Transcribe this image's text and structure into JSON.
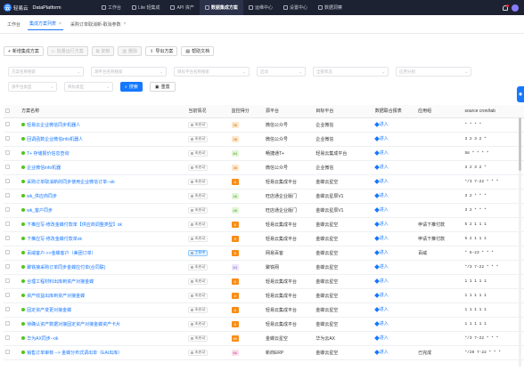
{
  "topnav": {
    "logo": "轻易云",
    "app_name": "DataPlatform",
    "items": [
      {
        "label": "工作台",
        "active": false
      },
      {
        "label": "Lite 轻集成",
        "active": false
      },
      {
        "label": "API 资产",
        "active": false
      },
      {
        "label": "数据集成方案",
        "active": true
      },
      {
        "label": "运维中心",
        "active": false
      },
      {
        "label": "设置中心",
        "active": false
      },
      {
        "label": "数据洞察",
        "active": false
      }
    ]
  },
  "tabs": [
    {
      "label": "工作台",
      "active": false
    },
    {
      "label": "集成方案列表",
      "active": true
    },
    {
      "label": "采购订单取消新-取消参数",
      "active": false
    }
  ],
  "toolbar": {
    "new": "新增集成方案",
    "batch_run": "批量运行方案",
    "copy": "复制",
    "delete": "删除",
    "export": "导出方案",
    "help": "帮助文档"
  },
  "filters": {
    "row1": [
      {
        "placeholder": "方案名称搜索",
        "w": 85
      },
      {
        "placeholder": "源平台名称搜索",
        "w": 85
      },
      {
        "placeholder": "目标平台名称搜索",
        "w": 85
      },
      {
        "placeholder": "启动",
        "w": 55
      },
      {
        "placeholder": "全部状态",
        "w": 85
      },
      {
        "placeholder": "应用分组",
        "w": 85
      }
    ],
    "row2": [
      {
        "placeholder": "源平台类型",
        "w": 55
      },
      {
        "placeholder": "目标类型",
        "w": 55
      }
    ],
    "search": "搜索",
    "reset": "重置"
  },
  "table": {
    "headers": [
      "方案名称",
      "当前情况",
      "监控得分",
      "源平台",
      "目标平台",
      "数据联合报表",
      "应用组",
      "source cron/tab"
    ],
    "rows": [
      {
        "name": "轻易云企业微信同步机器人",
        "status": "未启动",
        "score": "38",
        "sc": "lorange",
        "src": "微信公众号",
        "dst": "企业微信",
        "rep": "进入",
        "grp": "",
        "cron": "* * * *"
      },
      {
        "name": "回调函数企业微信info机器人",
        "status": "未启动",
        "score": "38",
        "sc": "lorange",
        "src": "微信公众号",
        "dst": "企业微信",
        "rep": "进入",
        "grp": "",
        "cron": "3 2 3 2 *"
      },
      {
        "name": "T+ 存储报价信息查询",
        "status": "未启动",
        "score": "84",
        "sc": "lgreen",
        "src": "畅捷通T+",
        "dst": "轻易云集成平台",
        "rep": "进入",
        "grp": "",
        "cron": "58 * * * *"
      },
      {
        "name": "企业微信info机器",
        "status": "未启动",
        "score": "38",
        "sc": "lorange",
        "src": "微信公众号",
        "dst": "企业微信",
        "rep": "进入",
        "grp": "",
        "cron": "3 2 3 2 *"
      },
      {
        "name": "采购订单取消新的同步使用企业微信订单--ok",
        "status": "未启动",
        "score": "8",
        "sc": "orange",
        "src": "轻易云集成平台",
        "dst": "金蝶云星空",
        "rep": "进入",
        "grp": "",
        "cron": "*/3 7-22 * * *"
      },
      {
        "name": "wk_供应商同步",
        "status": "未启动",
        "score": "46",
        "sc": "lgreen",
        "src": "旺店通企业版门",
        "dst": "金蝶云星辰V1",
        "rep": "进入",
        "grp": "",
        "cron": "3 2 * * *"
      },
      {
        "name": "wk_客户同步",
        "status": "未启动",
        "score": "46",
        "sc": "lgreen",
        "src": "旺店通企业版门",
        "dst": "金蝶云星辰V1",
        "rep": "进入",
        "grp": "",
        "cron": "3 2 * * *"
      },
      {
        "name": "下推应写-修改金蝶付款单【供应商调整类型】ok",
        "status": "未启动",
        "score": "8",
        "sc": "orange",
        "src": "轻易云集成平台",
        "dst": "金蝶云星空",
        "rep": "进入",
        "grp": "申请下推付款",
        "cron": "5 2 1 1 1"
      },
      {
        "name": "下推应写-修改金蝶付款单ok",
        "status": "未启动",
        "score": "8",
        "sc": "orange",
        "src": "轻易云集成平台",
        "dst": "金蝶云星空",
        "rep": "进入",
        "grp": "申请下推付款",
        "cron": "5 2 1 1 1"
      },
      {
        "name": "百威客户->>金蝶客户（美团订单）",
        "status": "工作中",
        "score": "8",
        "sc": "orange",
        "src": "网易百客",
        "dst": "金蝶云星空",
        "rep": "进入",
        "grp": "百威",
        "cron": "* 6-23 * * *"
      },
      {
        "name": "聚铁接采购订单同步金蝶应付单(合同联)",
        "status": "未启动",
        "score": "64",
        "sc": "lpurple",
        "src": "聚铁网",
        "dst": "金蝶云星空",
        "rep": "进入",
        "grp": "",
        "cron": "*/3 7-22 * * *"
      },
      {
        "name": "合理工程材料出库到资产对接金蝶",
        "status": "未启动",
        "score": "8",
        "sc": "orange",
        "src": "轻易云集成平台",
        "dst": "金蝶云星空",
        "rep": "进入",
        "grp": "",
        "cron": "1 1 1 1 1"
      },
      {
        "name": "资产收益出库到资产对接金蝶",
        "status": "未启动",
        "score": "8",
        "sc": "orange",
        "src": "轻易云集成平台",
        "dst": "金蝶云星空",
        "rep": "进入",
        "grp": "",
        "cron": "1 1 1 1 1"
      },
      {
        "name": "固定资产变更对接金蝶",
        "status": "未启动",
        "score": "8",
        "sc": "orange",
        "src": "轻易云集成平台",
        "dst": "金蝶云星空",
        "rep": "进入",
        "grp": "",
        "cron": "1 1 1 1 1"
      },
      {
        "name": "待确认资产数据对接固定资产对接金蝶资产卡片",
        "status": "未启动",
        "score": "8",
        "sc": "orange",
        "src": "轻易云集成平台",
        "dst": "金蝶云星空",
        "rep": "进入",
        "grp": "",
        "cron": "1 1 1 1 1"
      },
      {
        "name": "华为AX同步--ok",
        "status": "未启动",
        "score": "60",
        "sc": "orange",
        "src": "金蝶云星空",
        "dst": "华为云AX",
        "rep": "进入",
        "grp": "",
        "cron": "*/3 7-22 * * *"
      },
      {
        "name": "销售订单审核 --> 金蝶分布式调出单（EAI出库）",
        "status": "未启动",
        "score": "60",
        "sc": "pink",
        "src": "新商ERP",
        "dst": "金蝶云星空",
        "rep": "进入",
        "grp": "已完成",
        "cron": "*/20 7-22 * * *"
      }
    ]
  }
}
